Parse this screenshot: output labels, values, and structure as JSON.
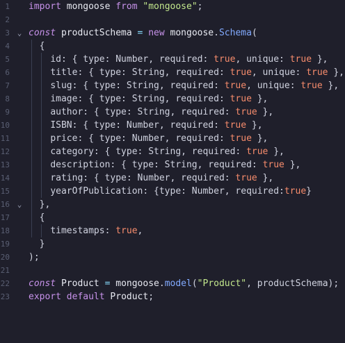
{
  "editor": {
    "line_numbers": [
      "1",
      "2",
      "3",
      "4",
      "5",
      "6",
      "7",
      "8",
      "9",
      "10",
      "11",
      "12",
      "13",
      "14",
      "15",
      "16",
      "17",
      "18",
      "19",
      "20",
      "21",
      "22",
      "23"
    ],
    "colors": {
      "background": "#1f1f2b",
      "keyword": "#c792ea",
      "string": "#c3e88d",
      "boolean": "#f78c6c",
      "type": "#d0d3e0",
      "class": "#82aaff",
      "punctuation": "#89ddff",
      "property": "#ffcb6b"
    },
    "fold_icons": [
      "chevron-down-icon",
      "chevron-down-icon"
    ],
    "fold_symbol": "⌄",
    "lines": [
      "import mongoose from \"mongoose\";",
      "",
      "const productSchema = new mongoose.Schema(",
      "  {",
      "    id: { type: Number, required: true, unique: true },",
      "    title: { type: String, required: true, unique: true },",
      "    slug: { type: String, required: true, unique: true },",
      "    image: { type: String, required: true },",
      "    author: { type: String, required: true },",
      "    ISBN: { type: Number, required: true },",
      "    price: { type: Number, required: true },",
      "    category: { type: String, required: true },",
      "    description: { type: String, required: true },",
      "    rating: { type: Number, required: true },",
      "    yearOfPublication: {type: Number, required:true}",
      "  },",
      "  {",
      "    timestamps: true,",
      "  }",
      ");",
      "",
      "const Product = mongoose.model(\"Product\", productSchema);",
      "export default Product;"
    ]
  }
}
